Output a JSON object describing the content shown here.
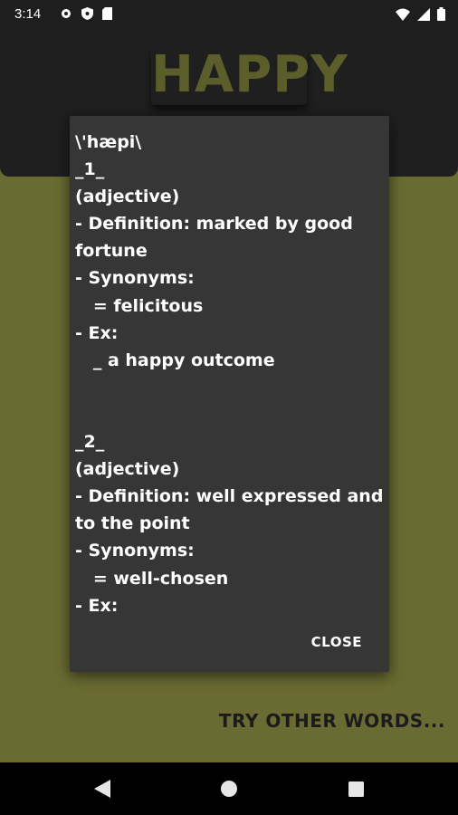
{
  "status": {
    "time": "3:14",
    "left_icons": [
      "gear-icon",
      "shield-icon",
      "sd-card-icon"
    ],
    "right_icons": [
      "wifi-icon",
      "signal-icon",
      "battery-icon"
    ]
  },
  "header": {
    "title": "HAPPY"
  },
  "dialog": {
    "content": "\\'hæpi\\\n_1_\n(adjective)\n- Definition: marked by good\nfortune\n- Synonyms:\n   = felicitous\n- Ex:\n   _ a happy outcome\n\n\n_2_\n(adjective)\n- Definition: well expressed and\nto the point\n- Synonyms:\n   = well-chosen\n- Ex:",
    "close_label": "CLOSE"
  },
  "footer": {
    "try_label": "TRY OTHER WORDS..."
  },
  "nav": {
    "icons": [
      "back-icon",
      "home-icon",
      "recents-icon"
    ]
  },
  "colors": {
    "background": "#6a6b32",
    "header": "#1f1f1f",
    "title": "#5b5d2b",
    "dialog": "#363636"
  }
}
